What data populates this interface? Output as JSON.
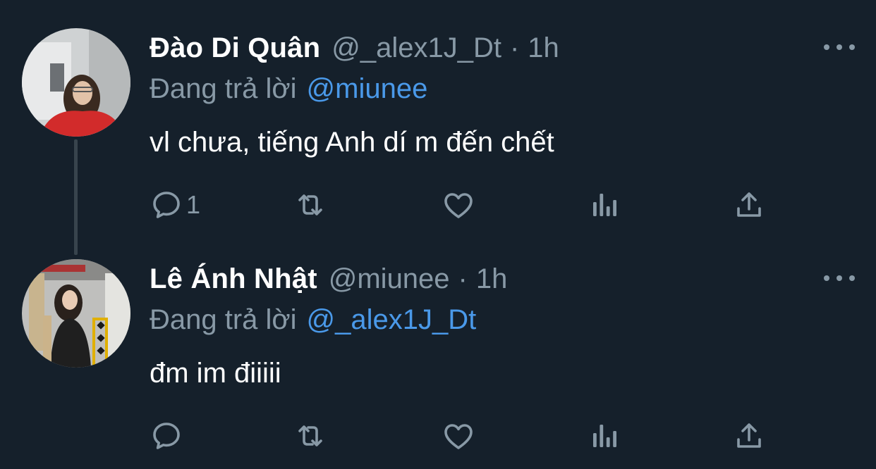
{
  "tweets": [
    {
      "name": "Đào Di Quân",
      "handle": "@_alex1J_Dt",
      "separator": "·",
      "time": "1h",
      "replying_prefix": "Đang trả lời",
      "replying_to": "@miunee",
      "text": "vl chưa, tiếng Anh dí m đến chết",
      "reply_count": "1"
    },
    {
      "name": "Lê Ánh Nhật",
      "handle": "@miunee",
      "separator": "·",
      "time": "1h",
      "replying_prefix": "Đang trả lời",
      "replying_to": "@_alex1J_Dt",
      "text": "đm im điiiii",
      "reply_count": ""
    }
  ],
  "icons": {
    "reply": "reply-icon",
    "retweet": "retweet-icon",
    "like": "heart-icon",
    "stats": "analytics-icon",
    "share": "share-icon",
    "more": "more-dots-icon"
  },
  "colors": {
    "background": "#15202b",
    "primary_text": "#ffffff",
    "secondary_text": "#8899a6",
    "link": "#4a99e9",
    "thread_line": "#38444d"
  }
}
